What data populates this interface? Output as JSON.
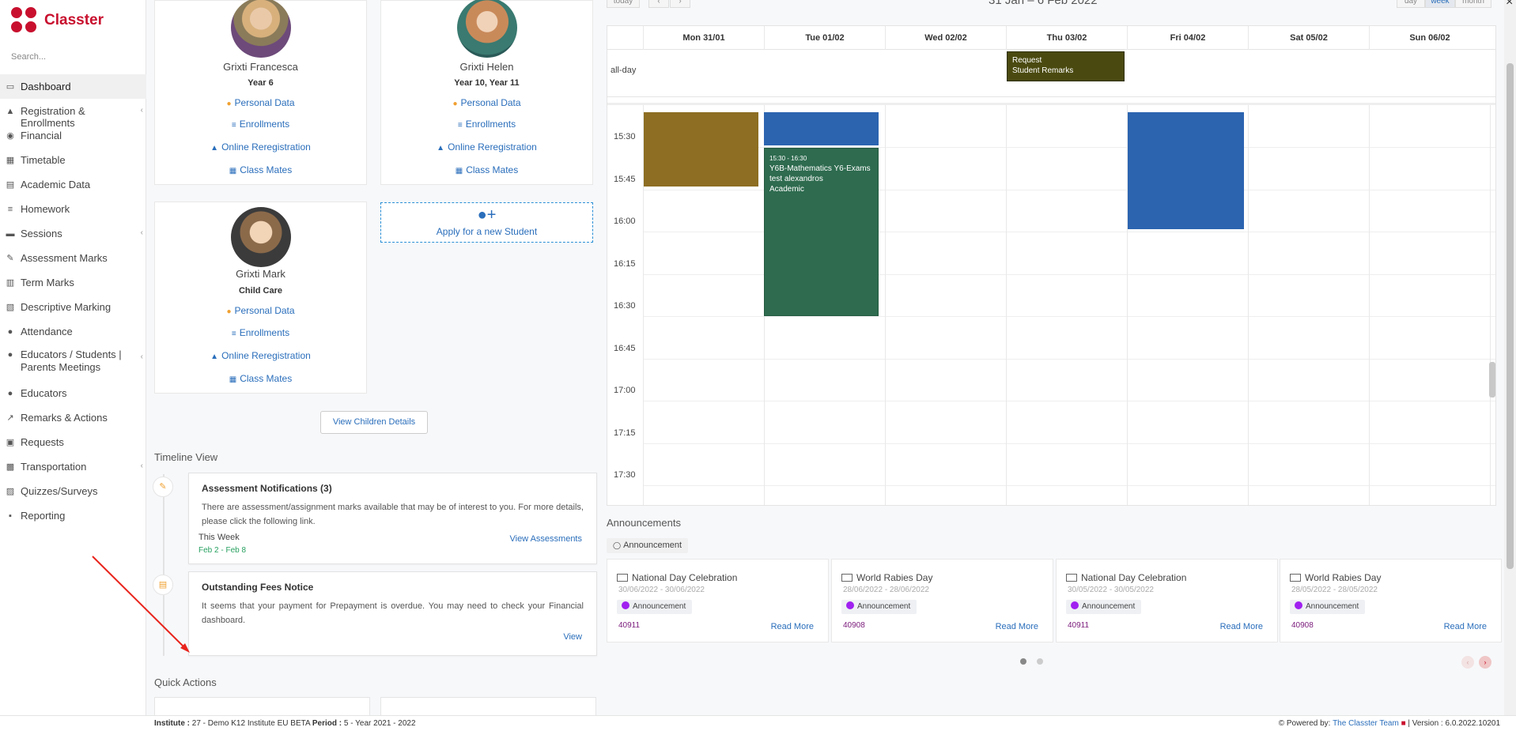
{
  "brand": {
    "name": "Classter"
  },
  "sidebar": {
    "search_placeholder": "Search...",
    "items": [
      {
        "label": "Dashboard",
        "icon": "laptop-icon",
        "active": true
      },
      {
        "label": "Registration & Enrollments",
        "icon": "institution-icon",
        "chevron": true
      },
      {
        "label": "Financial",
        "icon": "coins-icon"
      },
      {
        "label": "Timetable",
        "icon": "calendar-icon"
      },
      {
        "label": "Academic Data",
        "icon": "id-card-icon"
      },
      {
        "label": "Homework",
        "icon": "list-icon"
      },
      {
        "label": "Sessions",
        "icon": "chalkboard-icon",
        "chevron": true
      },
      {
        "label": "Assessment Marks",
        "icon": "edit-icon"
      },
      {
        "label": "Term Marks",
        "icon": "book-icon"
      },
      {
        "label": "Descriptive Marking",
        "icon": "pen-square-icon"
      },
      {
        "label": "Attendance",
        "icon": "user-check-icon"
      },
      {
        "label": "Educators / Students | Parents Meetings",
        "icon": "users-icon",
        "chevron": true
      },
      {
        "label": "Educators",
        "icon": "user-group-icon"
      },
      {
        "label": "Remarks & Actions",
        "icon": "trend-icon"
      },
      {
        "label": "Requests",
        "icon": "inbox-icon"
      },
      {
        "label": "Transportation",
        "icon": "bus-icon",
        "chevron": true
      },
      {
        "label": "Quizzes/Surveys",
        "icon": "clipboard-icon"
      },
      {
        "label": "Reporting",
        "icon": "print-icon"
      }
    ]
  },
  "children": [
    {
      "name": "Grixti Francesca",
      "year": "Year 6",
      "links": [
        "Personal Data",
        "Enrollments",
        "Online Reregistration",
        "Class Mates"
      ]
    },
    {
      "name": "Grixti Helen",
      "year": "Year 10, Year 11",
      "links": [
        "Personal Data",
        "Enrollments",
        "Online Reregistration",
        "Class Mates"
      ]
    },
    {
      "name": "Grixti Mark",
      "year": "Child Care",
      "links": [
        "Personal Data",
        "Enrollments",
        "Online Reregistration",
        "Class Mates"
      ]
    }
  ],
  "apply_new_student": "Apply for a new Student",
  "view_children_details": "View Children Details",
  "timeline": {
    "title": "Timeline View",
    "items": [
      {
        "title": "Assessment Notifications (3)",
        "body": "There are assessment/assignment marks available that may be of interest to you. For more details, please click the following link.",
        "meta": "This Week",
        "date": "Feb 2 - Feb 8",
        "link": "View Assessments"
      },
      {
        "title": "Outstanding Fees Notice",
        "body": "It seems that your payment for Prepayment is overdue. You may need to check your Financial dashboard.",
        "link": "View"
      }
    ]
  },
  "quick_actions": {
    "title": "Quick Actions"
  },
  "calendar": {
    "buttons": {
      "today": "today",
      "prev": "‹",
      "next": "›",
      "day": "day",
      "week": "week",
      "month": "month"
    },
    "range": "31 Jan – 6 Feb 2022",
    "allday_label": "all-day",
    "days": [
      "Mon 31/01",
      "Tue 01/02",
      "Wed 02/02",
      "Thu 03/02",
      "Fri 04/02",
      "Sat 05/02",
      "Sun 06/02"
    ],
    "allday_event": {
      "line1": "Request",
      "line2": "Student Remarks"
    },
    "times": [
      "15:30",
      "15:45",
      "16:00",
      "16:15",
      "16:30",
      "16:45",
      "17:00",
      "17:15",
      "17:30"
    ],
    "event_green": {
      "time": "15:30 - 16:30",
      "title": "Y6B-Mathematics Y6-Exams",
      "line2": "test alexandros",
      "line3": "Academic"
    },
    "colors": {
      "olive": "#8d6e22",
      "blue": "#2c64b0",
      "green": "#2e6b4f",
      "allday": "#4a4a10"
    }
  },
  "announcements": {
    "title": "Announcements",
    "filter_tag": "Announcement",
    "items": [
      {
        "title": "National Day Celebration",
        "dates": "30/06/2022 - 30/06/2022",
        "badge": "Announcement",
        "number": "40911",
        "more": "Read More"
      },
      {
        "title": "World Rabies Day",
        "dates": "28/06/2022 - 28/06/2022",
        "badge": "Announcement",
        "number": "40908",
        "more": "Read More"
      },
      {
        "title": "National Day Celebration",
        "dates": "30/05/2022 - 30/05/2022",
        "badge": "Announcement",
        "number": "40911",
        "more": "Read More"
      },
      {
        "title": "World Rabies Day",
        "dates": "28/05/2022 - 28/05/2022",
        "badge": "Announcement",
        "number": "40908",
        "more": "Read More"
      }
    ]
  },
  "footer": {
    "institute_label": "Institute :",
    "institute_value": "27 - Demo K12 Institute EU BETA",
    "period_label": "Period :",
    "period_value": "5 - Year 2021 - 2022",
    "powered_by": "Powered by:",
    "team": "The Classter Team",
    "version": "| Version : 6.0.2022.10201"
  }
}
